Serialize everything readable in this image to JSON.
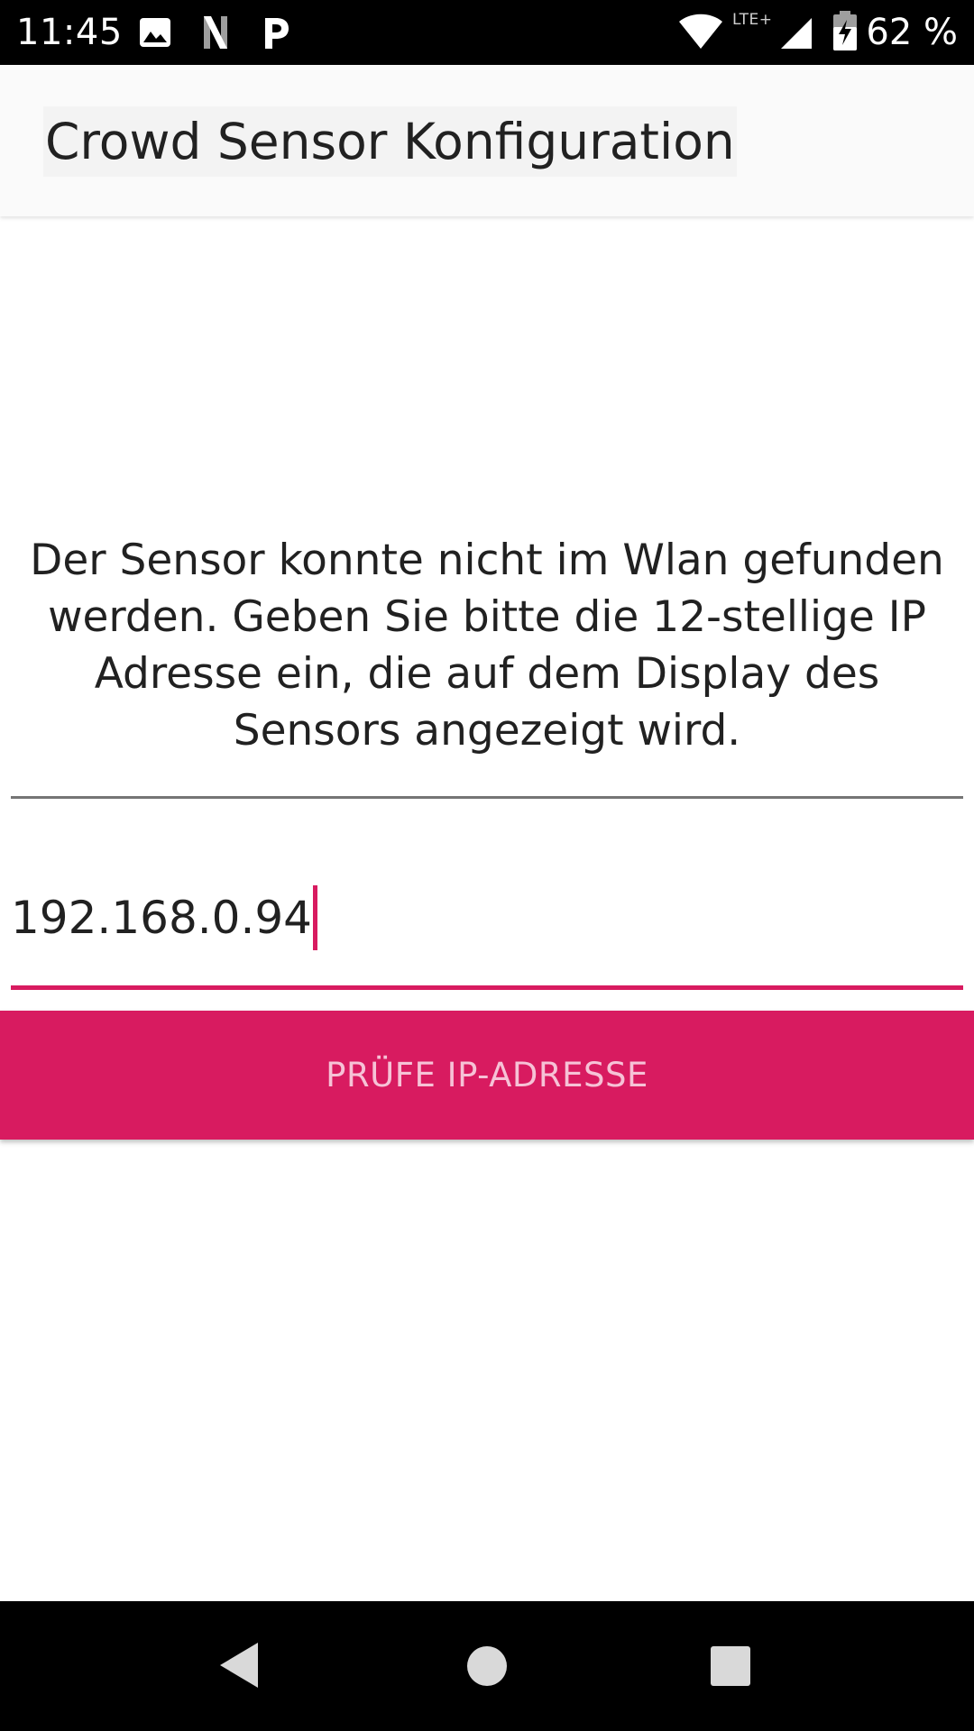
{
  "status_bar": {
    "time": "11:45",
    "network_type": "LTE+",
    "battery_percent": "62 %",
    "icons": [
      "image-icon",
      "netflix-icon",
      "parking-icon",
      "wifi-icon",
      "cell-signal-icon",
      "battery-charging-icon"
    ]
  },
  "app_bar": {
    "title": "Crowd Sensor Konfiguration"
  },
  "content": {
    "message": "Der Sensor konnte nicht im Wlan gefunden werden. Geben Sie bitte die 12-stellige IP Adresse ein, die auf dem Display des Sensors angezeigt wird.",
    "ip_input": {
      "value": "192.168.0.94"
    },
    "check_button_label": "PRÜFE IP-ADRESSE"
  },
  "nav_bar": {
    "buttons": [
      "back-icon",
      "home-icon",
      "recents-icon"
    ]
  },
  "colors": {
    "accent": "#d81b60",
    "button_text": "#f6c2d6",
    "status_bar": "#000000",
    "app_bar": "#fafafa",
    "text_primary": "#212121"
  }
}
